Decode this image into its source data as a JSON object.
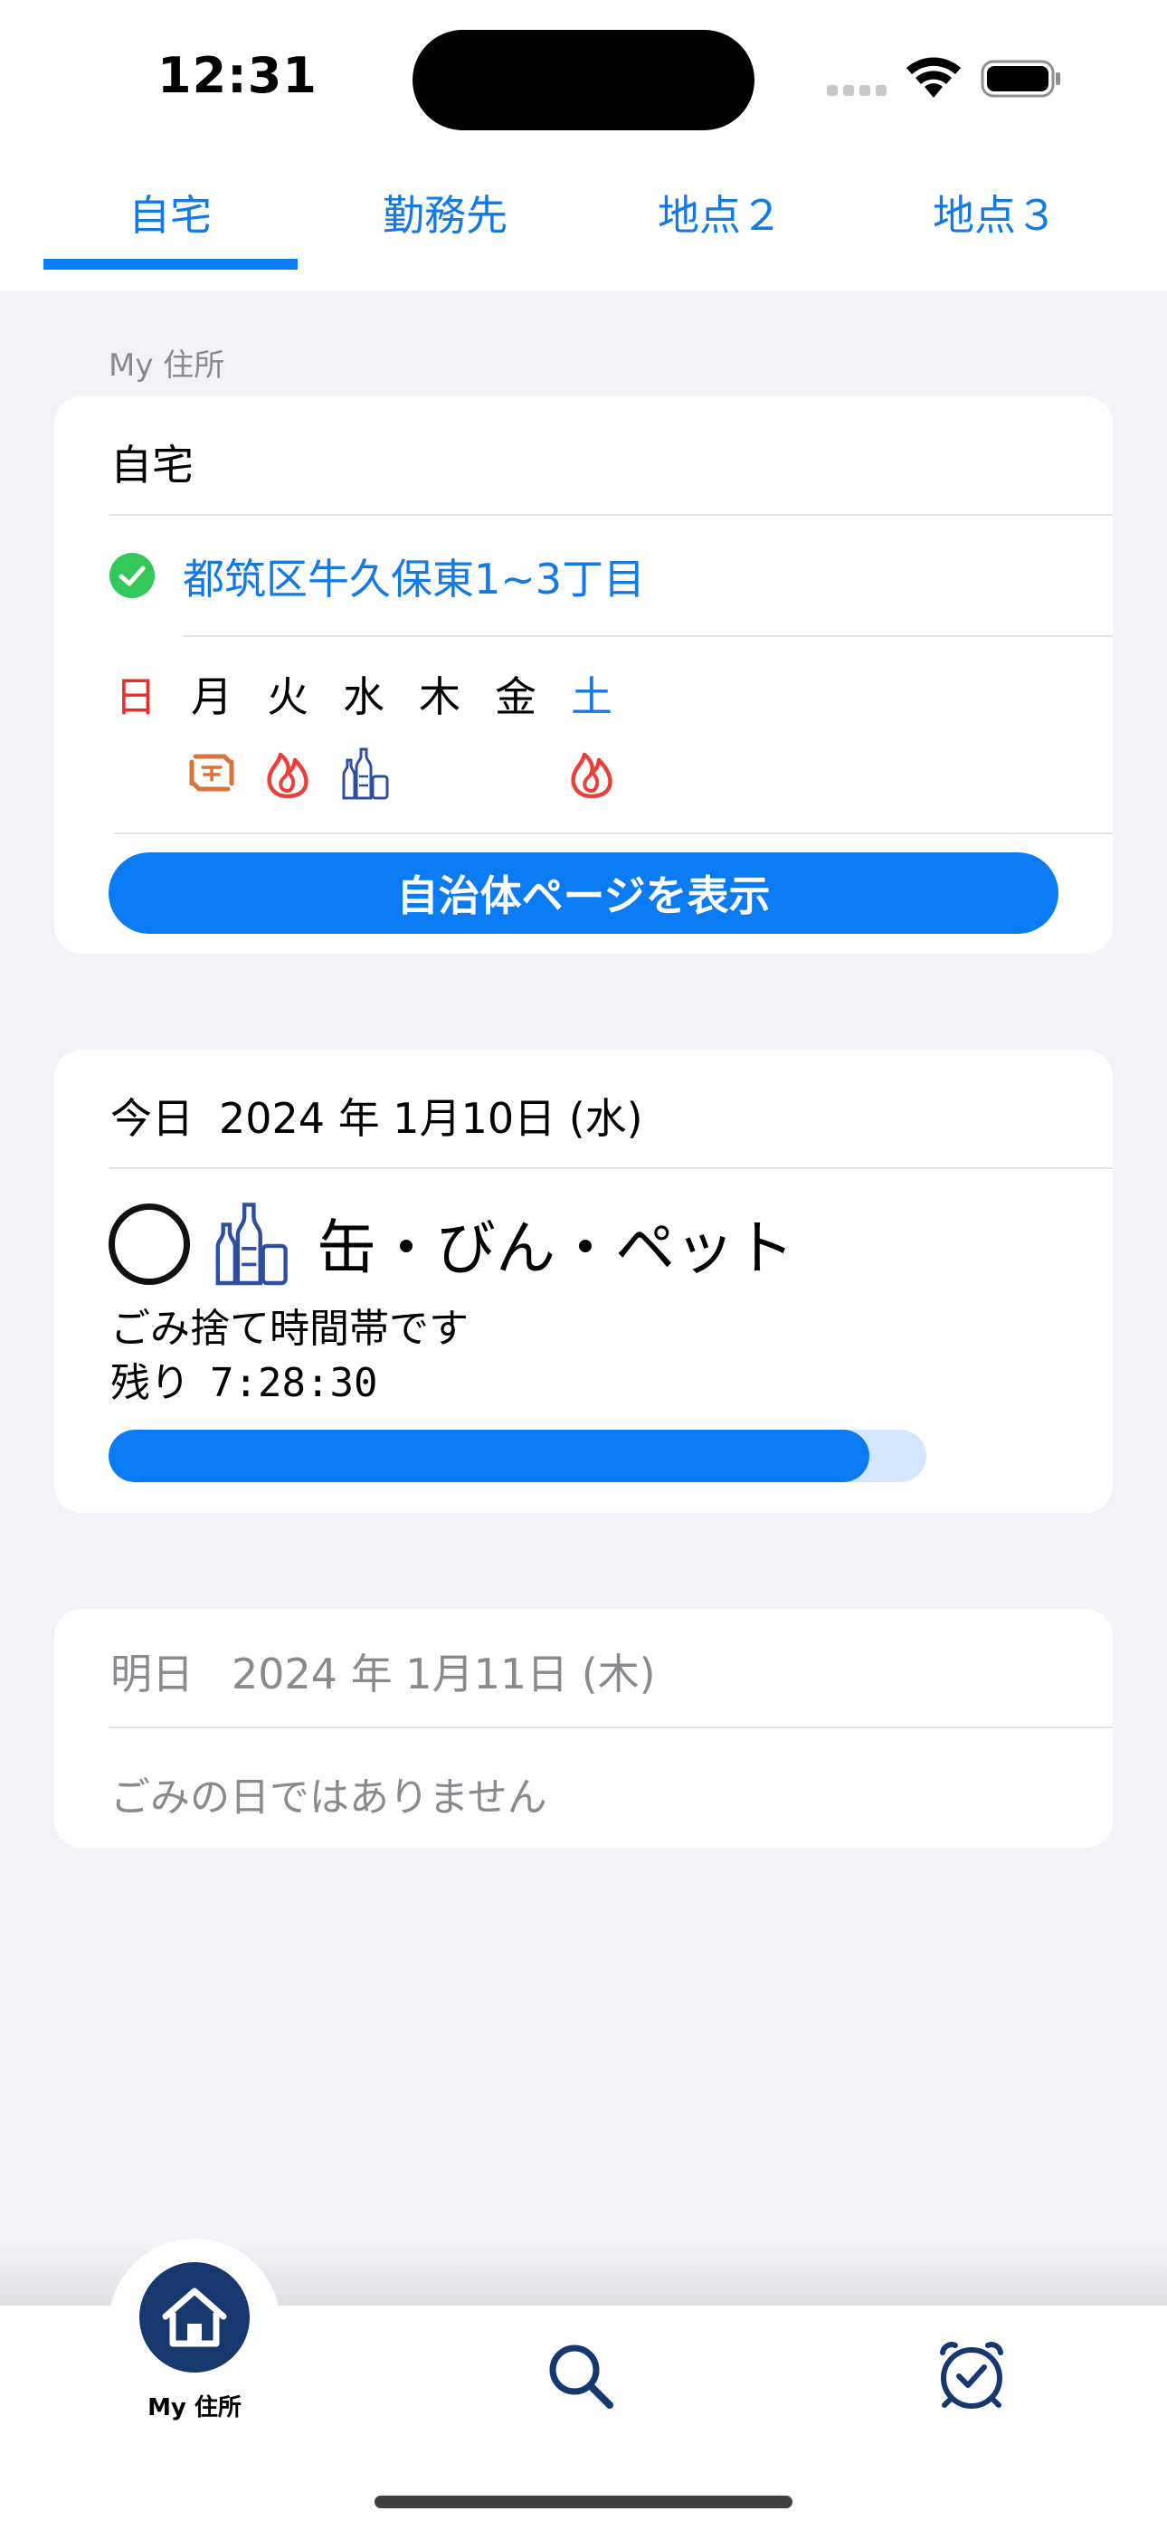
{
  "status_bar": {
    "time": "12:31",
    "wifi_icon": "wifi-icon",
    "battery_icon": "battery-icon"
  },
  "tabs": [
    {
      "label": "自宅",
      "selected": true
    },
    {
      "label": "勤務先",
      "selected": false
    },
    {
      "label": "地点２",
      "selected": false
    },
    {
      "label": "地点３",
      "selected": false
    }
  ],
  "section_label": "My 住所",
  "location_card": {
    "name": "自宅",
    "address": "都筑区牛久保東1~3丁目",
    "address_icon": "check-circle-icon",
    "weekdays": [
      "日",
      "月",
      "火",
      "水",
      "木",
      "金",
      "土"
    ],
    "collection_icons": {
      "mon": "recycle-paper-icon",
      "tue": "burnable-fire-icon",
      "wed": "bottles-cans-icon",
      "sat": "burnable-fire-icon"
    },
    "button_label": "自治体ページを表示"
  },
  "today_card": {
    "label": "今日",
    "date": "2024 年 1月10日 (水)",
    "mark": "○",
    "garbage_type": "缶・びん・ペット",
    "status": "ごみ捨て時間帯です",
    "remaining_label": "残り",
    "remaining_time": "7:28:30",
    "progress_fraction": 0.93
  },
  "tomorrow_card": {
    "label": "明日",
    "date": "2024 年 1月11日 (木)",
    "message": "ごみの日ではありません"
  },
  "tabbar": {
    "home_label": "My 住所",
    "home_icon": "house-icon",
    "search_icon": "search-icon",
    "clock_icon": "alarm-clock-icon"
  },
  "colors": {
    "accent": "#0a7bf3",
    "sunday": "#e3302b",
    "navy": "#17376f",
    "fire": "#e8403a",
    "paper": "#d9733a"
  }
}
